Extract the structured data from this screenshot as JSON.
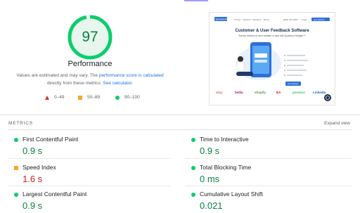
{
  "score": {
    "value": "97",
    "fraction": 0.97,
    "ring_color": "#0cce6b",
    "bg_color": "#e8f7ee",
    "text_color": "#0b8043",
    "title": "Performance"
  },
  "description": {
    "text_before": "Values are estimated and may vary. The ",
    "link1": "performance score is calculated",
    "text_middle": " directly from these metrics. ",
    "link2": "See calculator."
  },
  "legend": [
    {
      "icon": "red-triangle-icon",
      "range": "0–49"
    },
    {
      "icon": "orange-square-icon",
      "range": "50–89"
    },
    {
      "icon": "green-circle-icon",
      "range": "90–100"
    }
  ],
  "screenshot": {
    "logo": "QuestionPro",
    "nav": [
      "Pricing",
      "Features",
      "Solutions",
      "Demo"
    ],
    "phone": "(800) 792-0080",
    "login": "Login",
    "cta": "Get Started",
    "heading": "Customer & User Feedback Software",
    "subheading": "Survey visitors on your website or app with Qualaroo Nudges™",
    "bullets": [
      "",
      "",
      "",
      "",
      ""
    ],
    "button": "Get Started",
    "brands": [
      "ebay",
      "bellio",
      "shopify",
      "EA",
      "greedoor",
      "LinkedIn"
    ]
  },
  "metrics_header": "METRICS",
  "expand_view": "Expand view",
  "metrics": [
    {
      "label": "First Contentful Paint",
      "value": "0.9 s",
      "status": "good",
      "icon": "green-circle-icon"
    },
    {
      "label": "Time to Interactive",
      "value": "0.9 s",
      "status": "good",
      "icon": "green-circle-icon"
    },
    {
      "label": "Speed Index",
      "value": "1.6 s",
      "status": "bad",
      "icon": "orange-square-icon"
    },
    {
      "label": "Total Blocking Time",
      "value": "0 ms",
      "status": "good",
      "icon": "green-circle-icon"
    },
    {
      "label": "Largest Contentful Paint",
      "value": "0.9 s",
      "status": "good",
      "icon": "green-circle-icon"
    },
    {
      "label": "Cumulative Layout Shift",
      "value": "0.021",
      "status": "good",
      "icon": "green-circle-icon"
    }
  ],
  "colors": {
    "good": "#0cce6b",
    "average": "#f9a825",
    "poor": "#d93025",
    "link": "#1a73e8",
    "brand_blue": "#2f6fd8"
  }
}
